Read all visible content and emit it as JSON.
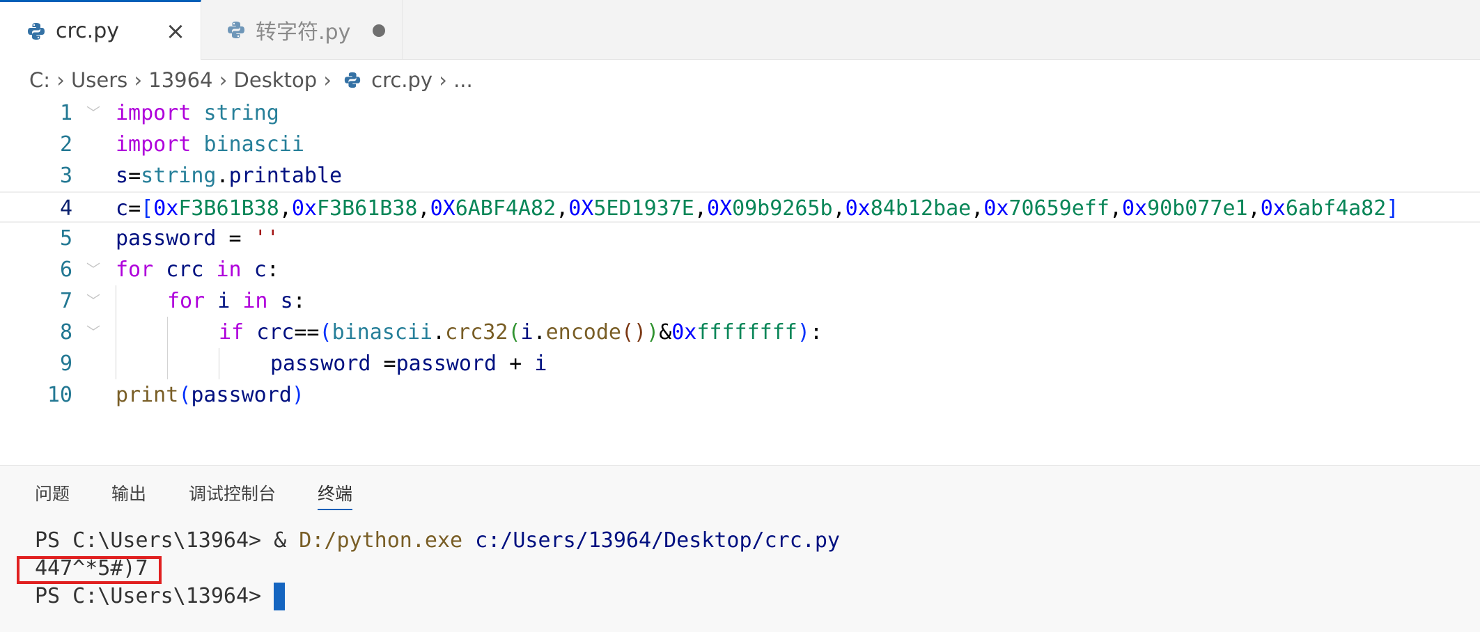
{
  "tabs": [
    {
      "label": "crc.py",
      "active": true,
      "close_symbol": "×"
    },
    {
      "label": "转字符.py",
      "active": false,
      "modified": true
    }
  ],
  "breadcrumb": [
    "C:",
    "Users",
    "13964",
    "Desktop",
    "crc.py",
    "..."
  ],
  "editor": {
    "current_line": 4,
    "line_numbers": [
      "1",
      "2",
      "3",
      "4",
      "5",
      "6",
      "7",
      "8",
      "9",
      "10"
    ],
    "code": {
      "l1": {
        "kw": "import",
        "mod": "string"
      },
      "l2": {
        "kw": "import",
        "mod": "binascii"
      },
      "l3": {
        "var": "s",
        "op": "=",
        "mod": "string",
        "dot": ".",
        "attr": "printable"
      },
      "l4": {
        "var": "c",
        "op": "=",
        "open": "[",
        "close": "]",
        "comma": ",",
        "values": [
          {
            "prefix": "0x",
            "digits": "F3B61B38"
          },
          {
            "prefix": "0x",
            "digits": "F3B61B38"
          },
          {
            "prefix": "0X",
            "digits": "6ABF4A82"
          },
          {
            "prefix": "0X",
            "digits": "5ED1937E"
          },
          {
            "prefix": "0X",
            "digits": "09b9265b"
          },
          {
            "prefix": "0x",
            "digits": "84b12bae"
          },
          {
            "prefix": "0x",
            "digits": "70659eff"
          },
          {
            "prefix": "0x",
            "digits": "90b077e1"
          },
          {
            "prefix": "0x",
            "digits": "6abf4a82"
          }
        ]
      },
      "l5": {
        "var": "password",
        "op": " = ",
        "str": "''"
      },
      "l6": {
        "kw1": "for",
        "v1": "crc",
        "kw2": "in",
        "v2": "c",
        "colon": ":"
      },
      "l7": {
        "kw1": "for",
        "v1": "i",
        "kw2": "in",
        "v2": "s",
        "colon": ":"
      },
      "l8": {
        "kw": "if",
        "v1": "crc",
        "op": "==",
        "p1": "(",
        "mod": "binascii",
        "dot": ".",
        "fn": "crc32",
        "p2": "(",
        "v2": "i",
        "dot2": ".",
        "fn2": "encode",
        "p3": "()",
        "p4": ")",
        "amp": "&",
        "hexprefix": "0x",
        "hexdigits": "ffffffff",
        "p5": ")",
        "colon": ":"
      },
      "l9": {
        "v1": "password",
        "op": " =",
        "v2": "password",
        "plus": " + ",
        "v3": "i"
      },
      "l10": {
        "fn": "print",
        "p1": "(",
        "v": "password",
        "p2": ")"
      }
    }
  },
  "panel": {
    "tabs": [
      "问题",
      "输出",
      "调试控制台",
      "终端"
    ],
    "active_tab": "终端",
    "terminal": {
      "line1": {
        "prompt": "PS C:\\Users\\13964> ",
        "amp": "& ",
        "exe": "D:/python.exe",
        "arg": " c:/Users/13964/Desktop/crc.py"
      },
      "line2": "447^*5#)7",
      "line3": "PS C:\\Users\\13964> "
    }
  },
  "colors": {
    "accent": "#005fb8",
    "highlight_box": "#e02020",
    "cursor": "#1565c0"
  }
}
